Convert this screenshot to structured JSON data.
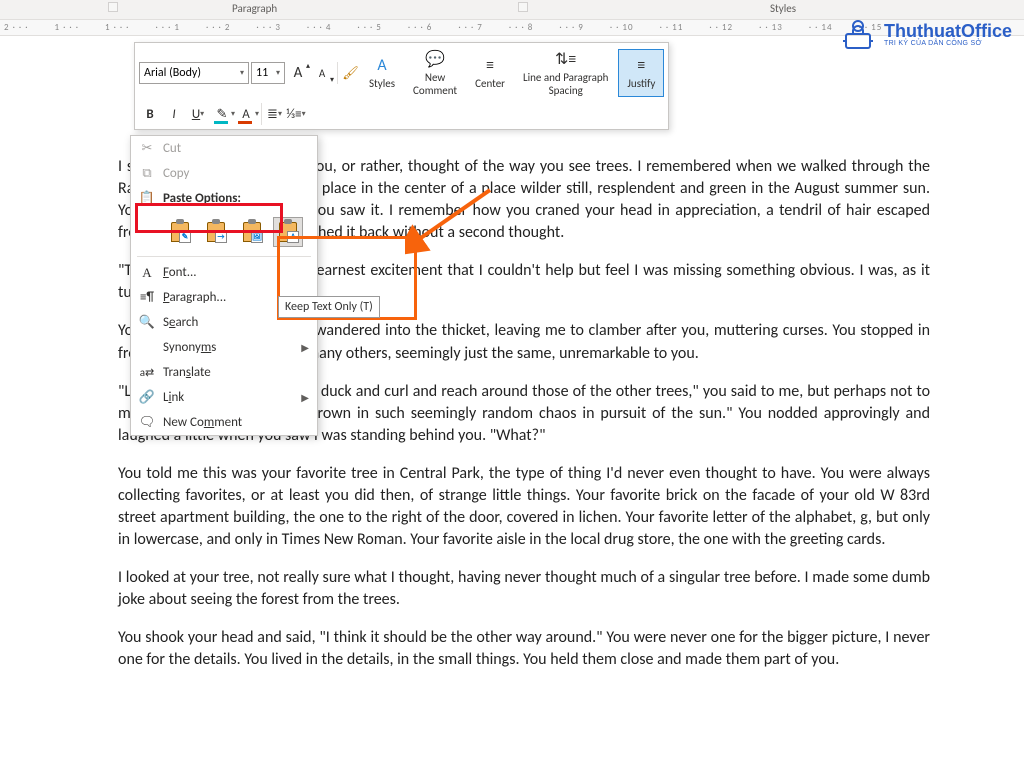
{
  "topbar": {
    "group_paragraph": "Paragraph",
    "group_styles": "Styles"
  },
  "ruler": [
    "2",
    "1",
    "1",
    "1",
    "2",
    "3",
    "4",
    "5",
    "6",
    "7",
    "8",
    "9",
    "10",
    "11",
    "12",
    "13",
    "14",
    "15"
  ],
  "toolbar": {
    "font_name": "Arial (Body)",
    "font_size": "11",
    "grow_font": "A",
    "shrink_font": "A",
    "bold": "B",
    "italic": "I",
    "underline": "U",
    "styles": "Styles",
    "new_comment": "New\nComment",
    "center": "Center",
    "line_spacing": "Line and Paragraph\nSpacing",
    "justify": "Justify"
  },
  "context": {
    "cut": "Cut",
    "copy": "Copy",
    "paste_options": "Paste Options:",
    "font": "Font...",
    "paragraph": "Paragraph...",
    "search": "Search",
    "synonyms": "Synonyms",
    "translate": "Translate",
    "link": "Link",
    "new_comment": "New Comment"
  },
  "tooltip": "Keep Text Only (T)",
  "watermark": {
    "title": "ThuthuatOffice",
    "sub": "TRI KỶ CỦA DÂN CÔNG SỞ"
  },
  "doc": {
    "p1": "I saw a tree, and thought of you, or rather, thought of the way you see trees. I remembered when we walked through the Ramble in Central Park, a wild place in the center of a place wilder still, resplendent and green in the August summer sun. You stopped suddenly when you saw it. I remember how you craned your head in appreciation, a tendril of hair escaped from behind your ear. You brushed it back without a second thought.",
    "p2": "\"There it is,\" you said in such earnest excitement that I couldn't help but feel I was missing something obvious. I was, as it turns out.",
    "p3": "You stepped off the path and wandered into the thicket, leaving me to clamber after you, muttering curses. You stopped in front of a tree, a tree among many others, seemingly just the same, unremarkable to you.",
    "p4": "\"Look at the way the branches duck and curl and reach around those of the other trees,\" you said to me, but perhaps not to me at all. \"The way they've grown in such seemingly random chaos in pursuit of the sun.\" You nodded approvingly and laughed a little when you saw I was standing behind you. \"What?\"",
    "p5": "You told me this was your favorite tree in Central Park, the type of thing I'd never even thought to have. You were always collecting favorites, or at least you did then, of strange little things. Your favorite brick on the facade of your old W 83rd street apartment building, the one to the right of the door, covered in lichen. Your favorite letter of the alphabet, g, but only in lowercase, and only in Times New Roman. Your favorite aisle in the local drug store, the one with the greeting cards.",
    "p6": "I looked at your tree, not really sure what I thought, having never thought much of a singular tree before. I made some dumb joke about seeing the forest from the trees.",
    "p7": "You shook your head and said, \"I think it should be the other way around.\" You were never one for the bigger picture, I never one for the details. You lived in the details, in the small things. You held them close and made them part of you."
  }
}
